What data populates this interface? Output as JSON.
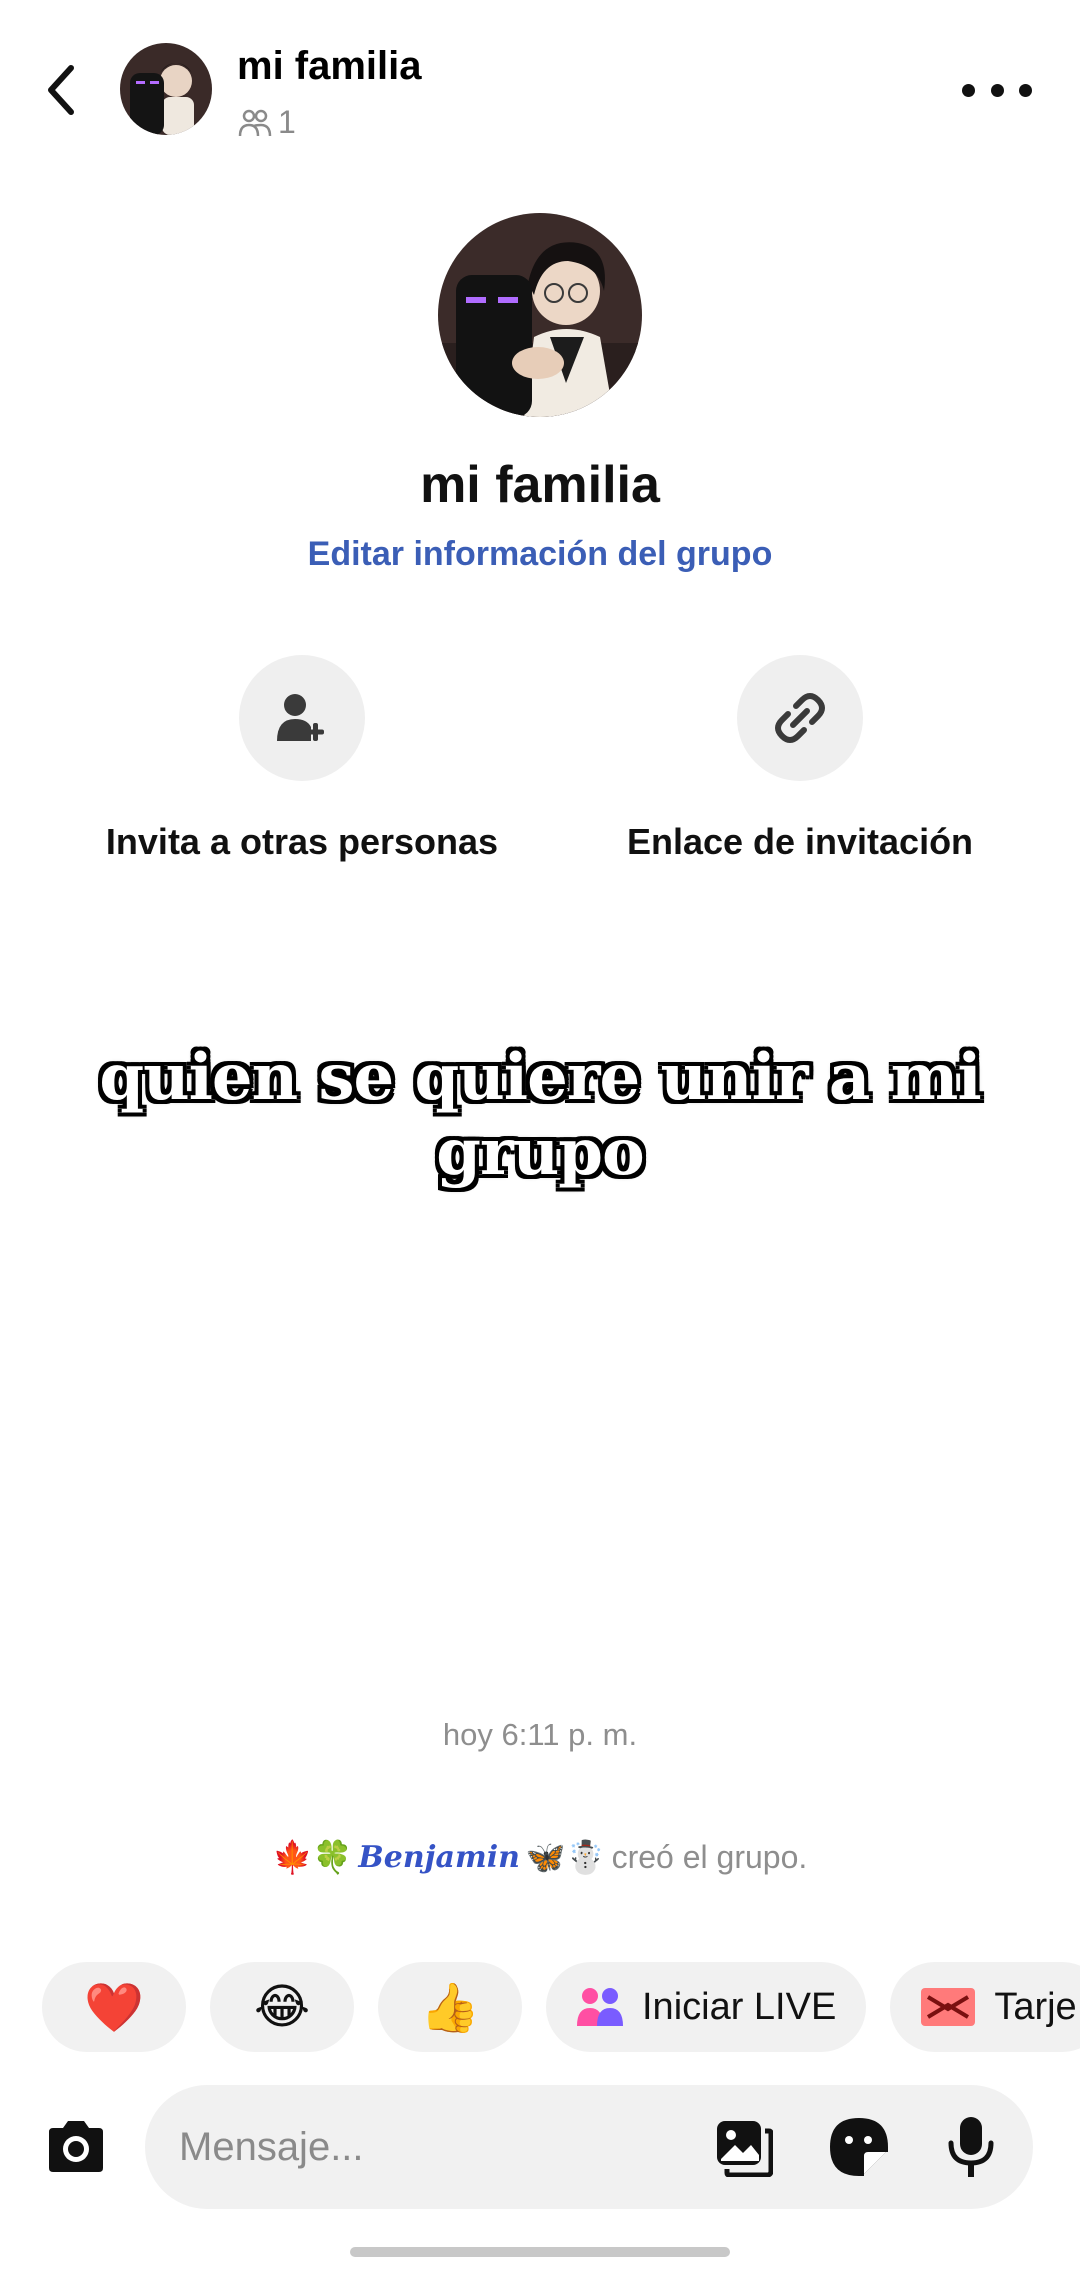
{
  "header": {
    "title": "mi familia",
    "member_count": "1",
    "back_icon": "chevron-left-icon",
    "more_icon": "more-horizontal-icon",
    "members_icon": "people-icon"
  },
  "group": {
    "name": "mi familia",
    "edit_label": "Editar información del grupo"
  },
  "actions": [
    {
      "label": "Invita a otras personas",
      "icon": "add-person-icon"
    },
    {
      "label": "Enlace de invitación",
      "icon": "link-icon"
    }
  ],
  "overlay_caption": "quien se quiere unir a mi grupo",
  "timeline": {
    "timestamp": "hoy 6:11 p. m.",
    "creator_prefix": "🍁🍀",
    "creator_name": "Benjamin",
    "creator_suffix": "🦋☃️",
    "created_text": "creó el grupo."
  },
  "quick_chips": [
    {
      "type": "emoji",
      "label": "❤️"
    },
    {
      "type": "emoji",
      "label": "😂"
    },
    {
      "type": "emoji",
      "label": "👍"
    },
    {
      "type": "action",
      "label": "Iniciar LIVE",
      "icon": "people-live-icon"
    },
    {
      "type": "action",
      "label": "Tarje",
      "icon": "card-icon"
    }
  ],
  "composer": {
    "placeholder": "Mensaje...",
    "camera_icon": "camera-icon",
    "gallery_icon": "gallery-icon",
    "sticker_icon": "sticker-icon",
    "mic_icon": "microphone-icon"
  },
  "colors": {
    "link_blue": "#3b5eb6",
    "muted_text": "#8e8e8e",
    "chip_bg": "#f1f1f1"
  }
}
